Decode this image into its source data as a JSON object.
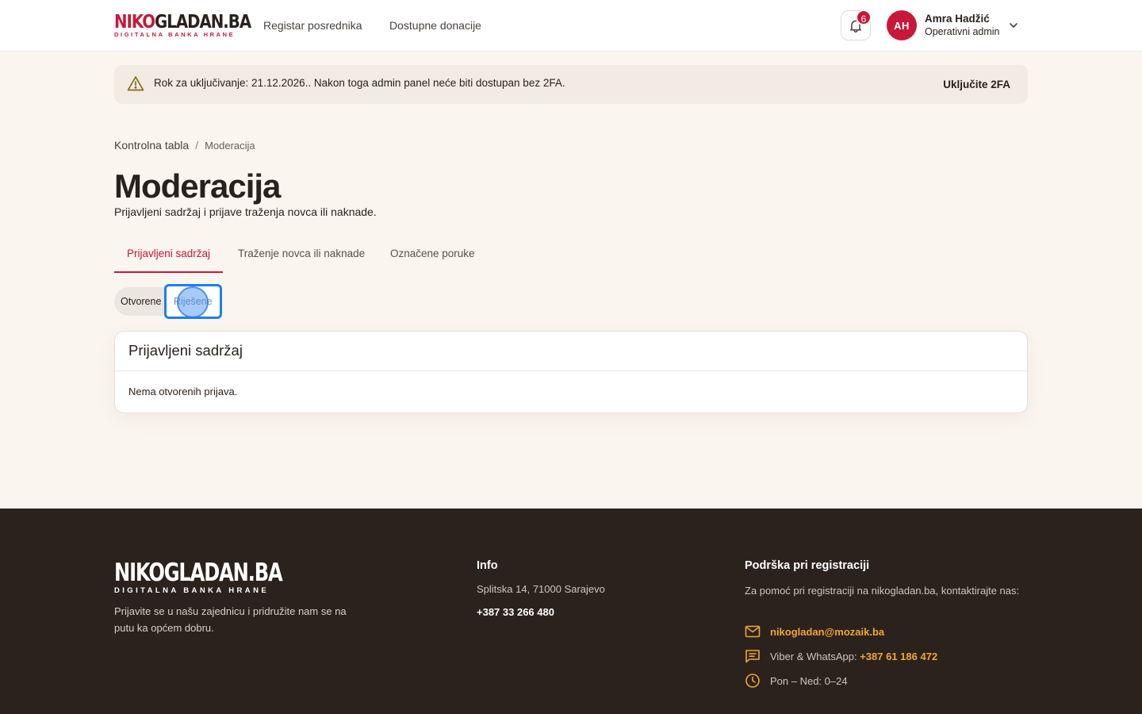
{
  "header": {
    "logo_main_red": "NIKO",
    "logo_main_dark": "GLADAN.BA",
    "logo_sub": "DIGITALNA BANKA HRANE",
    "nav": [
      "Registar posrednika",
      "Dostupne donacije"
    ],
    "notifications_count": "6",
    "user": {
      "initials": "AH",
      "name": "Amra Hadžić",
      "role": "Operativni admin"
    }
  },
  "banner": {
    "text": "Rok za uključivanje: 21.12.2026.. Nakon toga admin panel neće biti dostupan bez 2FA.",
    "action": "Uključite 2FA"
  },
  "breadcrumb": {
    "home": "Kontrolna tabla",
    "separator": "/",
    "current": "Moderacija"
  },
  "page": {
    "title": "Moderacija",
    "subtitle": "Prijavljeni sadržaj i prijave traženja novca ili naknade."
  },
  "tabs": [
    "Prijavljeni sadržaj",
    "Traženje novca ili naknade",
    "Označene poruke"
  ],
  "filter": {
    "open": "Otvorene",
    "resolved": "Riješene"
  },
  "card": {
    "title": "Prijavljeni sadržaj",
    "empty": "Nema otvorenih prijava."
  },
  "footer": {
    "logo_main": "NIKOGLADAN.BA",
    "logo_sub": "DIGITALNA BANKA HRANE",
    "description": "Prijavite se u našu zajednicu i pridružite nam se na putu ka općem dobru.",
    "info": {
      "heading": "Info",
      "address": "Splitska 14, 71000 Sarajevo",
      "phone": "+387 33 266 480"
    },
    "support": {
      "heading": "Podrška pri registraciji",
      "description": "Za pomoć pri registraciji na nikogladan.ba, kontaktirajte nas:",
      "email": "nikogladan@mozaik.ba",
      "viber_label": "Viber & WhatsApp:",
      "viber_number": "+387 61 186 472",
      "hours": "Pon – Ned: 0–24"
    }
  },
  "colors": {
    "brand_red": "#c8173a",
    "accent_orange": "#f0a630",
    "footer_bg": "#2b221e",
    "page_bg": "#faf5ef"
  }
}
